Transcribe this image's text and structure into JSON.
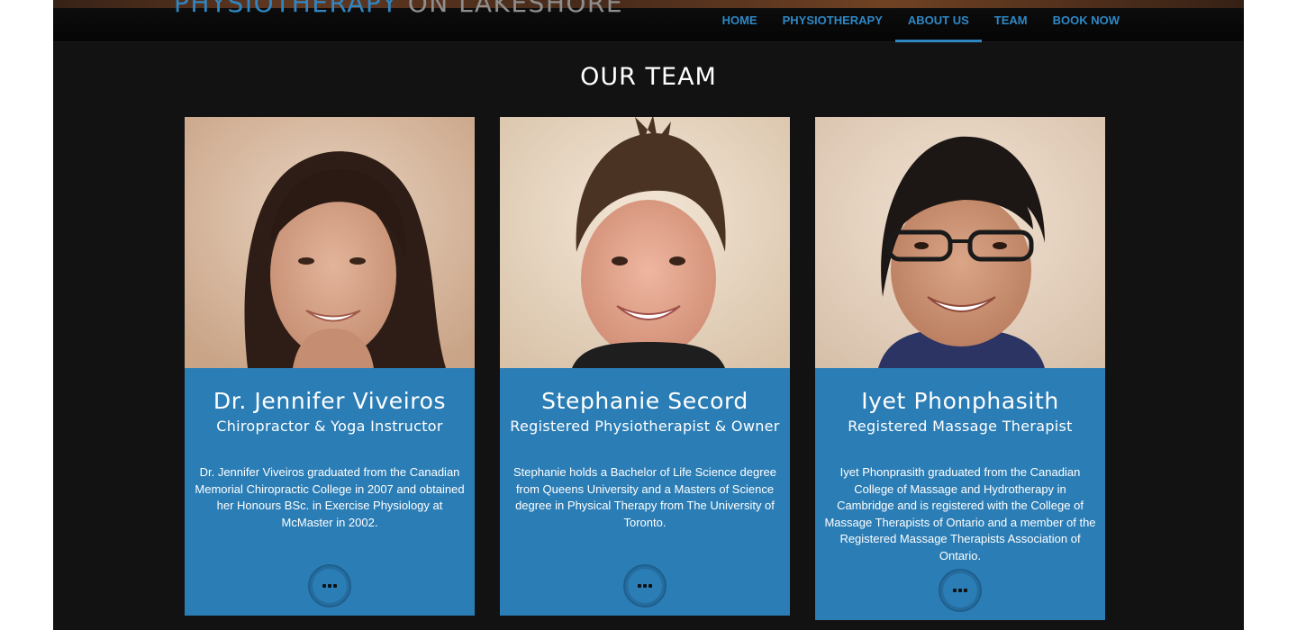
{
  "site": {
    "brand_part1": "PHYSIOTHERAPY",
    "brand_part2": "ON LAKESHORE"
  },
  "nav": {
    "items": [
      {
        "label": "HOME"
      },
      {
        "label": "PHYSIOTHERAPY"
      },
      {
        "label": "ABOUT US"
      },
      {
        "label": "TEAM"
      },
      {
        "label": "BOOK NOW"
      }
    ],
    "active": "ABOUT US"
  },
  "section": {
    "title": "OUR TEAM"
  },
  "team": [
    {
      "name": "Dr. Jennifer Viveiros",
      "role": "Chiropractor & Yoga Instructor",
      "bio": "Dr. Jennifer Viveiros graduated from the Canadian Memorial Chiropractic College in 2007 and obtained her Honours BSc. in Exercise Physiology at McMaster in 2002."
    },
    {
      "name": "Stephanie Secord",
      "role": "Registered Physiotherapist & Owner",
      "bio": "Stephanie holds a Bachelor of Life Science degree from Queens University and a Masters of Science degree in Physical Therapy from The University of Toronto."
    },
    {
      "name": "Iyet Phonphasith",
      "role": "Registered Massage Therapist",
      "bio": "Iyet Phonprasith graduated from the Canadian College of Massage and Hydrotherapy in Cambridge and is registered with the College of Massage Therapists of Ontario and a member of the Registered Massage Therapists Association of Ontario."
    }
  ],
  "colors": {
    "accent": "#2e86c1",
    "card": "#2b7db5",
    "background": "#121212"
  }
}
